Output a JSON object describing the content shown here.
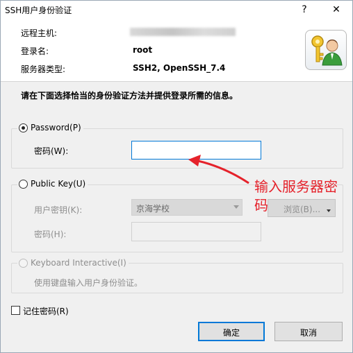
{
  "window": {
    "title": "SSH用户身份验证",
    "help_glyph": "?",
    "close_glyph": "✕"
  },
  "header": {
    "host_label": "远程主机:",
    "host_value": "",
    "login_label": "登录名:",
    "login_value": "root",
    "server_type_label": "服务器类型:",
    "server_type_value": "SSH2, OpenSSH_7.4",
    "icon": "user-key-icon"
  },
  "instruction": "请在下面选择恰当的身份验证方法并提供登录所需的信息。",
  "password_group": {
    "radio_label": "Password(P)",
    "selected": true,
    "field_label": "密码(W):",
    "field_value": ""
  },
  "publickey_group": {
    "radio_label": "Public Key(U)",
    "selected": false,
    "user_key_label": "用户密钥(K):",
    "user_key_value": "京海学校",
    "browse_label": "浏览(B)...",
    "passphrase_label": "密码(H):",
    "passphrase_value": ""
  },
  "keyboard_group": {
    "radio_label": "Keyboard Interactive(I)",
    "selected": false,
    "description": "使用键盘输入用户身份验证。"
  },
  "remember_password": {
    "label": "记住密码(R)",
    "checked": false
  },
  "buttons": {
    "ok": "确定",
    "cancel": "取消"
  },
  "annotation": {
    "line1": "输入服务器密",
    "line2": "码",
    "color": "#e5222b"
  }
}
